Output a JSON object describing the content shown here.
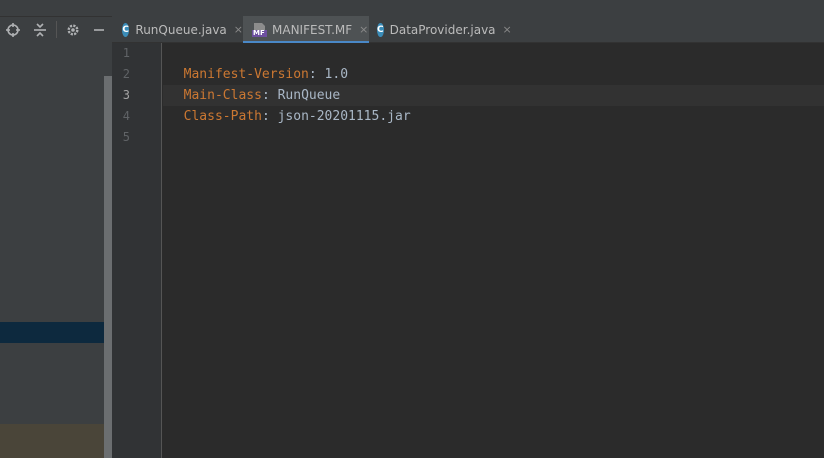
{
  "tabs": [
    {
      "label": "RunQueue.java",
      "icon": "java-class-icon",
      "active": false
    },
    {
      "label": "MANIFEST.MF",
      "icon": "manifest-file-icon",
      "active": true
    },
    {
      "label": "DataProvider.java",
      "icon": "java-class-icon",
      "active": false
    }
  ],
  "icons": {
    "class_letter": "C",
    "manifest_letters": "MF",
    "close": "×"
  },
  "toolbar": [
    "locate-icon",
    "collapse-all-icon",
    "gear-icon",
    "minimize-icon"
  ],
  "gutter": {
    "lines": [
      "1",
      "2",
      "3",
      "4",
      "5"
    ],
    "current": "3"
  },
  "code": [
    {
      "key": "Manifest-Version",
      "sep": ":",
      "value": " 1.0"
    },
    {
      "key": "Main-Class",
      "sep": ":",
      "value": " RunQueue"
    },
    {
      "key": "Class-Path",
      "sep": ":",
      "value": " json-20201115.jar"
    }
  ],
  "colors": {
    "accent": "#4a88c7",
    "key": "#cc7832",
    "text": "#a9b7c6",
    "selection": "#0d293e"
  }
}
